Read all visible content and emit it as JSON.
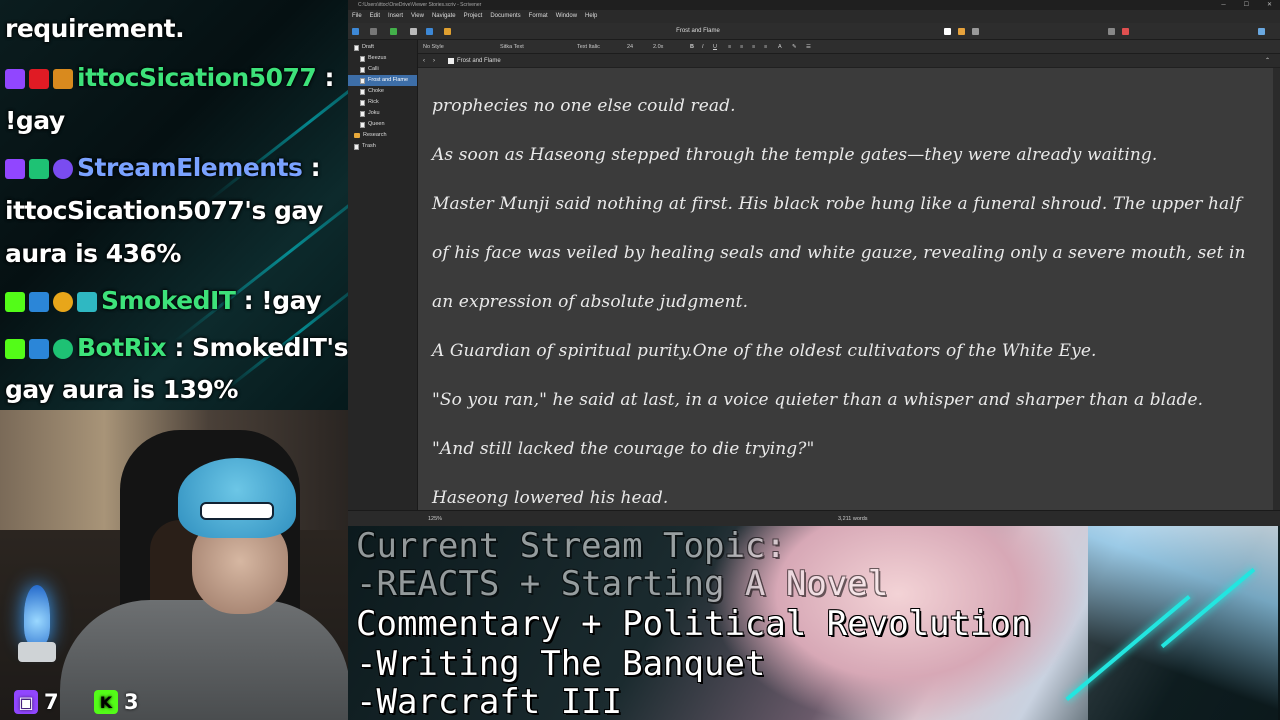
{
  "chat": {
    "lines": [
      {
        "text": "requirement.",
        "color": "#ffffff"
      },
      {
        "user": "ittocSication5077",
        "sep": " :",
        "color": "#3de27a"
      },
      {
        "text": "!gay",
        "color": "#ffffff"
      },
      {
        "user": "StreamElements",
        "sep": " :",
        "color": "#7aa2ff"
      },
      {
        "text": "ittocSication5077's gay",
        "color": "#ffffff"
      },
      {
        "text": "aura is 436%",
        "color": "#ffffff"
      },
      {
        "user": "SmokedIT",
        "msg": " : !gay",
        "color": "#3de27a"
      },
      {
        "user": "BotRix",
        "msg": " : SmokedIT's",
        "color": "#3de27a"
      },
      {
        "text": "gay aura is 139%",
        "color": "#ffffff"
      }
    ]
  },
  "counters": {
    "twitch": {
      "icon": "twitch-icon",
      "value": "7",
      "color": "#9146ff"
    },
    "kick": {
      "icon": "kick-icon",
      "value": "3",
      "color": "#53fc18"
    }
  },
  "scrivener": {
    "title": "C:\\Users\\ittoc\\OneDrive\\Viewer Stories.scriv - Scrivener",
    "menu": [
      "File",
      "Edit",
      "Insert",
      "View",
      "Navigate",
      "Project",
      "Documents",
      "Format",
      "Window",
      "Help"
    ],
    "doc_title": "Frost and Flame",
    "binder": [
      {
        "label": "Draft",
        "type": "folder"
      },
      {
        "label": "Beezus",
        "type": "doc"
      },
      {
        "label": "Calli",
        "type": "doc"
      },
      {
        "label": "Frost and Flame",
        "type": "doc",
        "selected": true
      },
      {
        "label": "Choke",
        "type": "doc"
      },
      {
        "label": "Rick",
        "type": "doc"
      },
      {
        "label": "Joku",
        "type": "doc"
      },
      {
        "label": "Queen",
        "type": "doc"
      },
      {
        "label": "Research",
        "type": "folder"
      },
      {
        "label": "Trash",
        "type": "folder"
      }
    ],
    "format": {
      "style": "No Style",
      "font": "Sitka Text",
      "face": "Text Italic",
      "size": "24",
      "spacing": "2.0x"
    },
    "paragraphs": [
      "prophecies no one else could read.",
      "As soon as Haseong stepped through the temple gates—they were already waiting.",
      "Master Munji said nothing at first. His black robe hung like a funeral shroud. The upper half",
      "of his face was veiled by healing seals and white gauze, revealing only a severe mouth, set in",
      "an expression of absolute judgment.",
      "A Guardian of spiritual purity.One of the oldest cultivators of the White Eye.",
      "\"So you ran,\" he said at last, in a voice quieter than a whisper and sharper than a blade.",
      "\"And still lacked the courage to die trying?\"",
      "Haseong lowered his head."
    ],
    "status": {
      "zoom": "125%",
      "word_count": "3,211 words"
    }
  },
  "topic": {
    "lines": [
      "Current Stream Topic:",
      "-REACTS + Starting A Novel",
      " Commentary + Political Revolution",
      "-Writing The Banquet",
      "-Warcraft III"
    ]
  }
}
